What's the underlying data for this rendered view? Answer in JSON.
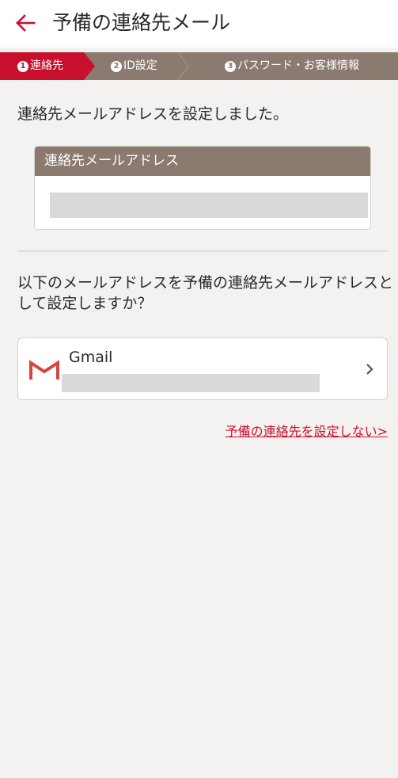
{
  "header": {
    "back_icon": "arrow-left-icon",
    "title": "予備の連絡先メール"
  },
  "steps": [
    {
      "number": "1",
      "label": "連絡先",
      "active": true
    },
    {
      "number": "2",
      "label": "ID設定",
      "active": false
    },
    {
      "number": "3",
      "label": "パスワード・お客様情報",
      "active": false
    }
  ],
  "main": {
    "message": "連絡先メールアドレスを設定しました。",
    "email_card": {
      "title": "連絡先メールアドレス"
    },
    "question": "以下のメールアドレスを予備の連絡先メールアドレスとして設定しますか？",
    "gmail_option": {
      "icon": "gmail-icon",
      "label": "Gmail",
      "chevron_icon": "chevron-right-icon"
    },
    "skip_link": "予備の連絡先を設定しない>"
  },
  "colors": {
    "accent": "#c8102e",
    "brown": "#8a7a6f",
    "background": "#f4f2f0"
  }
}
